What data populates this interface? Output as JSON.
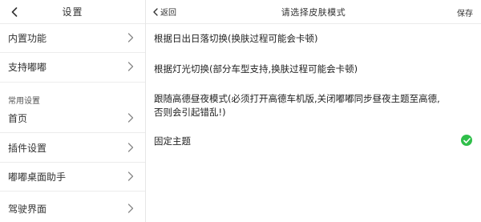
{
  "left_panel": {
    "title": "设置",
    "items": [
      {
        "label": "内置功能"
      },
      {
        "label": "支持嘟嘟"
      },
      {
        "label": "首页"
      },
      {
        "label": "插件设置"
      },
      {
        "label": "嘟嘟桌面助手"
      },
      {
        "label": "驾驶界面"
      }
    ],
    "group_label": "常用设置"
  },
  "right_panel": {
    "back_label": "返回",
    "title": "请选择皮肤模式",
    "save_label": "保存",
    "options": [
      {
        "label": "根据日出日落切换(换肤过程可能会卡顿)",
        "selected": false
      },
      {
        "label": "根据灯光切换(部分车型支持,换肤过程可能会卡顿)",
        "selected": false
      },
      {
        "label": "跟随高德昼夜模式(必须打开高德车机版,关闭嘟嘟同步昼夜主题至高德,否则会引起错乱!)",
        "selected": false
      },
      {
        "label": "固定主题",
        "selected": true
      }
    ]
  },
  "colors": {
    "check_green": "#2fbf4a",
    "divider": "#ececec"
  }
}
